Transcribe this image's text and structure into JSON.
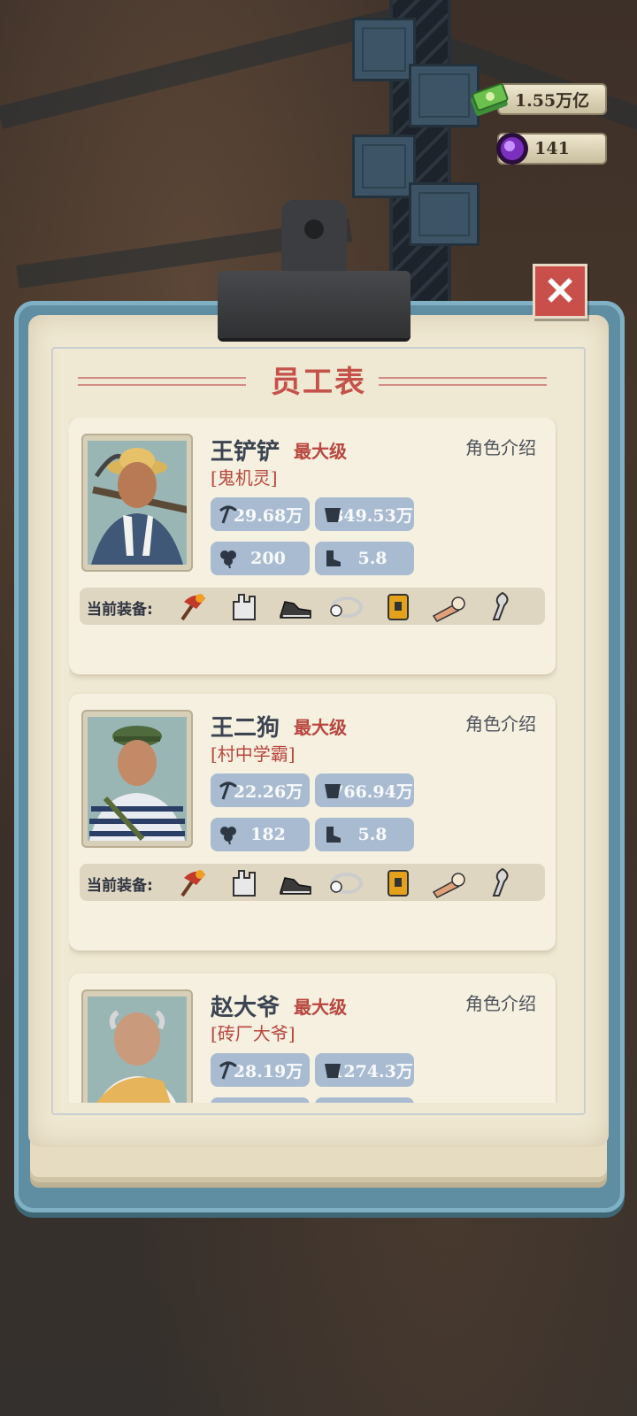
{
  "resources": [
    {
      "name": "cash",
      "icon": "cash-bundle-icon",
      "value": "1.55万亿"
    },
    {
      "name": "gem",
      "icon": "purple-orb-icon",
      "value": "141"
    }
  ],
  "panel": {
    "title": "员工表",
    "close_icon": "close-icon",
    "intro_label": "角色介绍",
    "max_level_label": "最大级",
    "equipment_label": "当前装备:"
  },
  "employees": [
    {
      "name": "王铲铲",
      "title_tag": "[鬼机灵]",
      "stats": {
        "mining": "29.68万",
        "capacity": "849.53万",
        "luck": "200",
        "speed": "5.8"
      },
      "equipment": [
        "pickaxe-icon",
        "gloves-icon",
        "shoes-icon",
        "headlamp-icon",
        "backpack-icon",
        "arm-guard-icon",
        "knee-pad-icon"
      ]
    },
    {
      "name": "王二狗",
      "title_tag": "[村中学霸]",
      "stats": {
        "mining": "22.26万",
        "capacity": "766.94万",
        "luck": "182",
        "speed": "5.8"
      },
      "equipment": [
        "pickaxe-icon",
        "gloves-icon",
        "shoes-icon",
        "headlamp-icon",
        "backpack-icon",
        "arm-guard-icon",
        "knee-pad-icon"
      ]
    },
    {
      "name": "赵大爷",
      "title_tag": "[砖厂大爷]",
      "stats": {
        "mining": "28.19万",
        "capacity": "1274.3万",
        "luck": "",
        "speed": ""
      },
      "equipment": []
    }
  ],
  "colors": {
    "accent_red": "#c4524a",
    "stat_blue": "#a9bbd0",
    "board_blue": "#5f8ea3",
    "paper": "#efe8d2"
  }
}
